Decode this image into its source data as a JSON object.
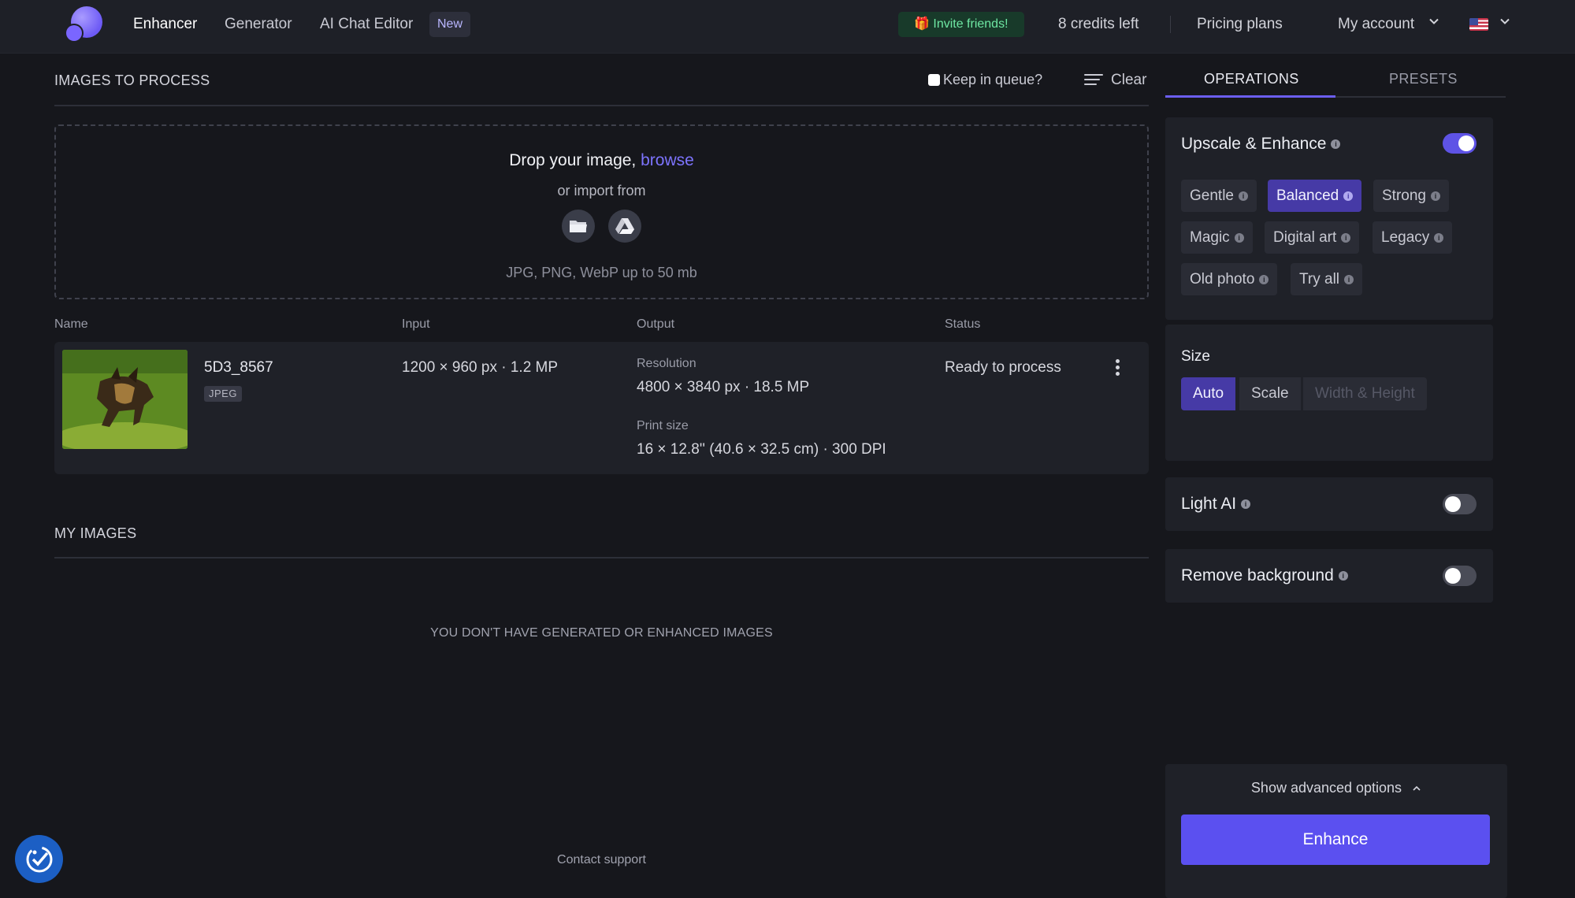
{
  "nav": {
    "links": [
      "Enhancer",
      "Generator",
      "AI Chat Editor"
    ],
    "new_badge": "New",
    "invite": "🎁 Invite friends!",
    "credits": "8 credits left",
    "pricing": "Pricing plans",
    "account": "My account"
  },
  "queue": {
    "title": "IMAGES TO PROCESS",
    "keep_label": "Keep in queue?",
    "clear_label": "Clear",
    "drop_text": "Drop your image,",
    "browse_text": "browse",
    "import_text": "or import from",
    "formats_text": "JPG, PNG, WebP up to 50 mb",
    "columns": [
      "Name",
      "Input",
      "Output",
      "Status"
    ],
    "item": {
      "name": "5D3_8567",
      "type": "JPEG",
      "input": "1200 × 960 px · 1.2 MP",
      "resolution_label": "Resolution",
      "resolution": "4800 × 3840 px · 18.5 MP",
      "print_label": "Print size",
      "print_size": "16 × 12.8'' (40.6 × 32.5 cm) · 300 DPI",
      "status": "Ready to process"
    }
  },
  "my_images": {
    "title": "MY IMAGES",
    "empty": "YOU DON'T HAVE GENERATED OR ENHANCED IMAGES"
  },
  "footer": {
    "contact": "Contact support"
  },
  "panel": {
    "tabs": [
      "OPERATIONS",
      "PRESETS"
    ],
    "upscale": {
      "title": "Upscale & Enhance",
      "enabled": true,
      "modes": [
        "Gentle",
        "Balanced",
        "Strong",
        "Magic",
        "Digital art",
        "Legacy",
        "Old photo",
        "Try all"
      ],
      "selected": "Balanced"
    },
    "size": {
      "title": "Size",
      "options": [
        "Auto",
        "Scale",
        "Width & Height"
      ],
      "selected": "Auto"
    },
    "light_ai": {
      "title": "Light AI",
      "enabled": false
    },
    "remove_bg": {
      "title": "Remove background",
      "enabled": false
    },
    "advanced_label": "Show advanced options",
    "enhance_label": "Enhance"
  },
  "colors": {
    "accent": "#5b50f0",
    "selected_chip": "#463aa6",
    "background": "#16171c"
  }
}
